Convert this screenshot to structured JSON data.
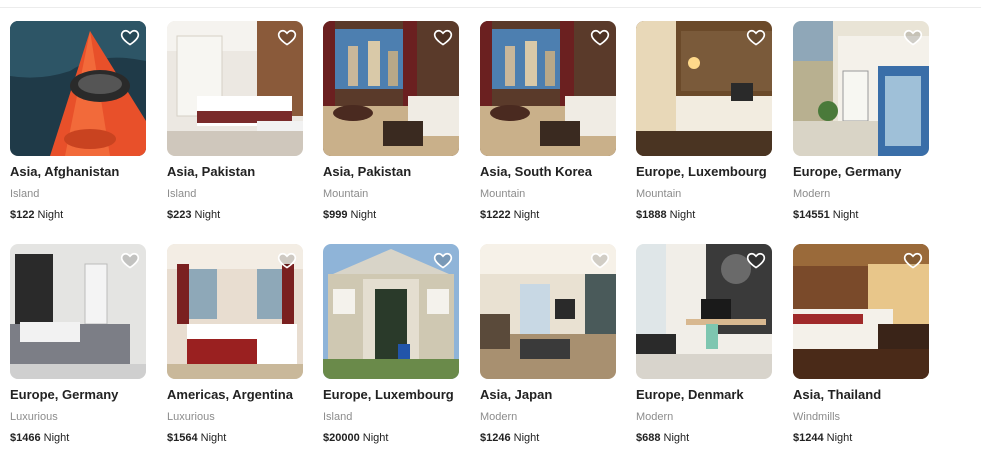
{
  "unit_label": "Night",
  "listings": [
    {
      "location": "Asia, Afghanistan",
      "category": "Island",
      "price": "$122"
    },
    {
      "location": "Asia, Pakistan",
      "category": "Island",
      "price": "$223"
    },
    {
      "location": "Asia, Pakistan",
      "category": "Mountain",
      "price": "$999"
    },
    {
      "location": "Asia, South Korea",
      "category": "Mountain",
      "price": "$1222"
    },
    {
      "location": "Europe, Luxembourg",
      "category": "Mountain",
      "price": "$1888"
    },
    {
      "location": "Europe, Germany",
      "category": "Modern",
      "price": "$14551"
    },
    {
      "location": "Europe, Germany",
      "category": "Luxurious",
      "price": "$1466"
    },
    {
      "location": "Americas, Argentina",
      "category": "Luxurious",
      "price": "$1564"
    },
    {
      "location": "Europe, Luxembourg",
      "category": "Island",
      "price": "$20000"
    },
    {
      "location": "Asia, Japan",
      "category": "Modern",
      "price": "$1246"
    },
    {
      "location": "Europe, Denmark",
      "category": "Modern",
      "price": "$688"
    },
    {
      "location": "Asia, Thailand",
      "category": "Windmills",
      "price": "$1244"
    }
  ]
}
